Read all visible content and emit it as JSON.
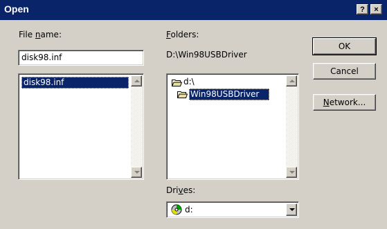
{
  "window": {
    "title": "Open",
    "help_btn": "?",
    "close_btn": "×"
  },
  "file_name": {
    "label_pre": "File ",
    "label_key": "n",
    "label_post": "ame:",
    "value": "disk98.inf",
    "list": [
      "disk98.inf"
    ],
    "selected_index": 0
  },
  "folders": {
    "label_key": "F",
    "label_post": "olders:",
    "current_path": "D:\\Win98USBDriver",
    "tree": [
      {
        "label": "d:\\",
        "icon": "open-folder-icon",
        "selected": false
      },
      {
        "label": "Win98USBDriver",
        "icon": "open-folder-icon",
        "selected": true
      }
    ]
  },
  "drives": {
    "label_pre": "Dri",
    "label_key": "v",
    "label_post": "es:",
    "value": "d:",
    "icon": "cd-drive-icon"
  },
  "buttons": {
    "ok": "OK",
    "cancel": "Cancel",
    "network_pre": "",
    "network_key": "N",
    "network_post": "etwork..."
  },
  "colors": {
    "face": "#d4d0c8",
    "titlebar": "#0a246a",
    "selection": "#0a246a"
  }
}
